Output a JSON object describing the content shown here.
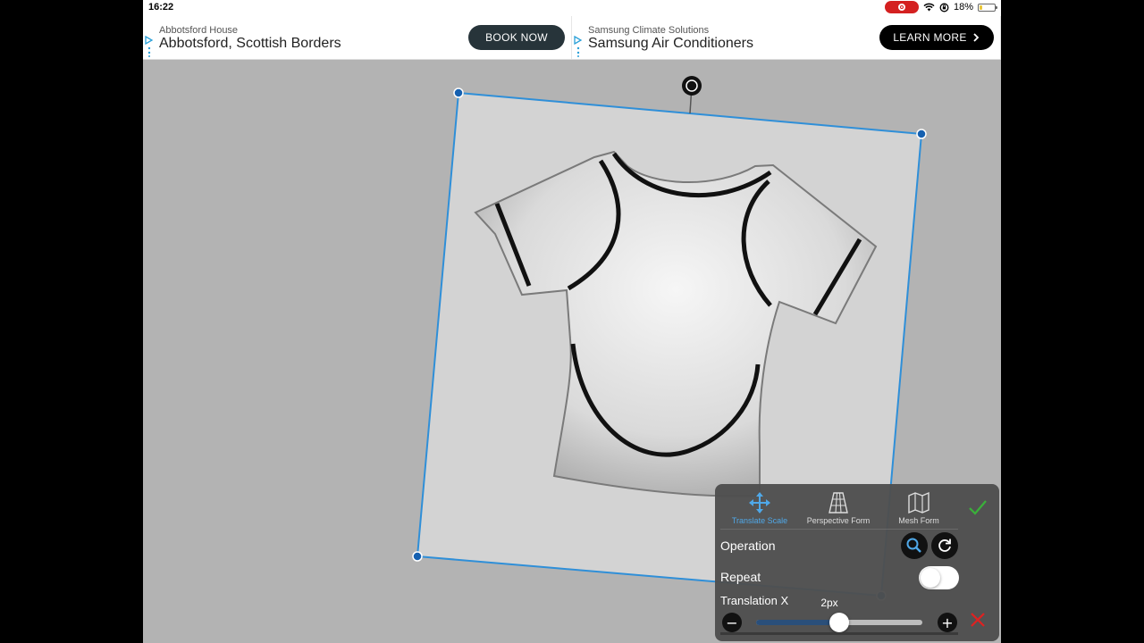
{
  "status_bar": {
    "time": "16:22",
    "battery_text": "18%",
    "battery_level": 0.18,
    "icons": [
      "screen-record-icon",
      "wifi-icon",
      "orientation-lock-icon",
      "battery-icon"
    ]
  },
  "ads": [
    {
      "sponsor": "Abbotsford House",
      "headline": "Abbotsford, Scottish Borders",
      "cta": "BOOK NOW"
    },
    {
      "sponsor": "Samsung Climate Solutions",
      "headline": "Samsung Air Conditioners",
      "cta": "LEARN MORE",
      "cta_icon": "chevron-right-icon"
    }
  ],
  "transform_tools": [
    {
      "label": "Translate Scale",
      "icon": "move-arrows-icon",
      "active": true
    },
    {
      "label": "Perspective Form",
      "icon": "perspective-grid-icon",
      "active": false
    },
    {
      "label": "Mesh Form",
      "icon": "mesh-map-icon",
      "active": false
    }
  ],
  "panel": {
    "operation_label": "Operation",
    "repeat_label": "Repeat",
    "repeat_on": false,
    "translation_label": "Translation X",
    "translation_value": "2px",
    "slider_fraction": 0.5
  },
  "colors": {
    "accent_blue": "#2f8fd8",
    "confirm_green": "#3ab03a",
    "cancel_red": "#e02020",
    "canvas_gray": "#b3b3b3",
    "layer_gray": "#d3d3d3"
  }
}
